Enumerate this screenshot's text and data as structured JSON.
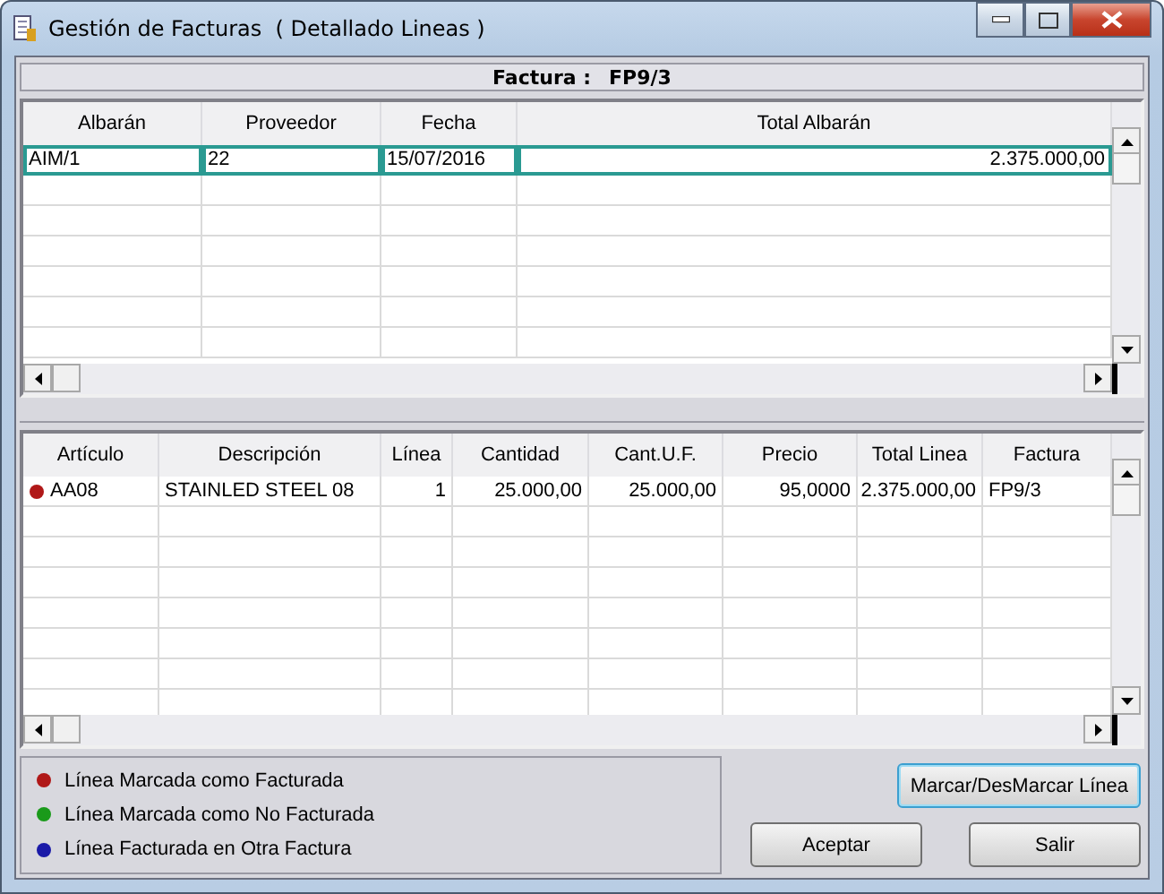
{
  "window": {
    "title": "Gestión de Facturas  ( Detallado Lineas )"
  },
  "invoice_header": {
    "label": "Factura :",
    "value": "FP9/3"
  },
  "delivery_notes": {
    "columns": [
      "Albarán",
      "Proveedor",
      "Fecha",
      "Total Albarán"
    ],
    "rows": [
      {
        "selected": true,
        "cells": [
          "AIM/1",
          "22",
          "15/07/2016",
          "2.375.000,00"
        ]
      }
    ]
  },
  "lines": {
    "columns": [
      "Artículo",
      "Descripción",
      "Línea",
      "Cantidad",
      "Cant.U.F.",
      "Precio",
      "Total Linea",
      "Factura"
    ],
    "rows": [
      {
        "color": "#b01818",
        "cells": [
          "AA08",
          "STAINLED STEEL 08",
          "1",
          "25.000,00",
          "25.000,00",
          "95,0000",
          "2.375.000,00",
          "FP9/3"
        ]
      }
    ]
  },
  "legend": [
    {
      "color": "#b01818",
      "label": "Línea Marcada como Facturada"
    },
    {
      "color": "#1a9a1a",
      "label": "Línea Marcada como No Facturada"
    },
    {
      "color": "#1a1aa8",
      "label": "Línea Facturada en Otra Factura"
    }
  ],
  "buttons": {
    "toggle": "Marcar/DesMarcar Línea",
    "accept": "Aceptar",
    "exit": "Salir"
  }
}
